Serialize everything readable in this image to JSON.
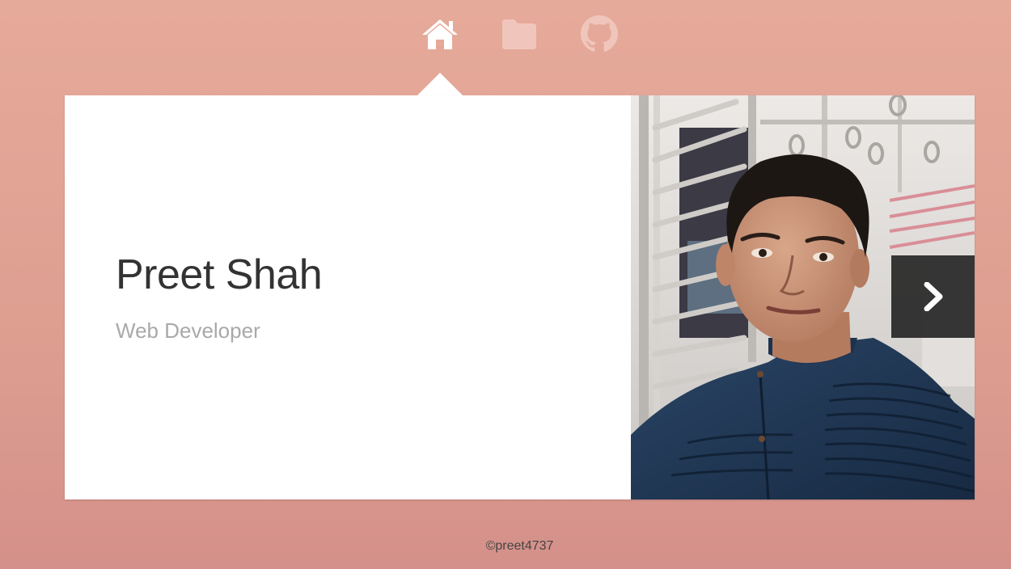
{
  "nav": {
    "items": [
      {
        "icon": "home-icon",
        "active": true
      },
      {
        "icon": "folder-icon",
        "active": false
      },
      {
        "icon": "github-icon",
        "active": false
      }
    ]
  },
  "profile": {
    "name": "Preet Shah",
    "role": "Web Developer"
  },
  "slider": {
    "next_icon": "chevron-right-icon"
  },
  "footer": {
    "text": "©preet4737"
  },
  "colors": {
    "background_top": "#e6aa9a",
    "background_bottom": "#d4908a",
    "card": "#ffffff",
    "name_text": "#333333",
    "role_text": "#a9a9a9",
    "nav_active": "#ffffff",
    "nav_inactive": "#f0c6bc",
    "shirt": "#1f3550"
  }
}
